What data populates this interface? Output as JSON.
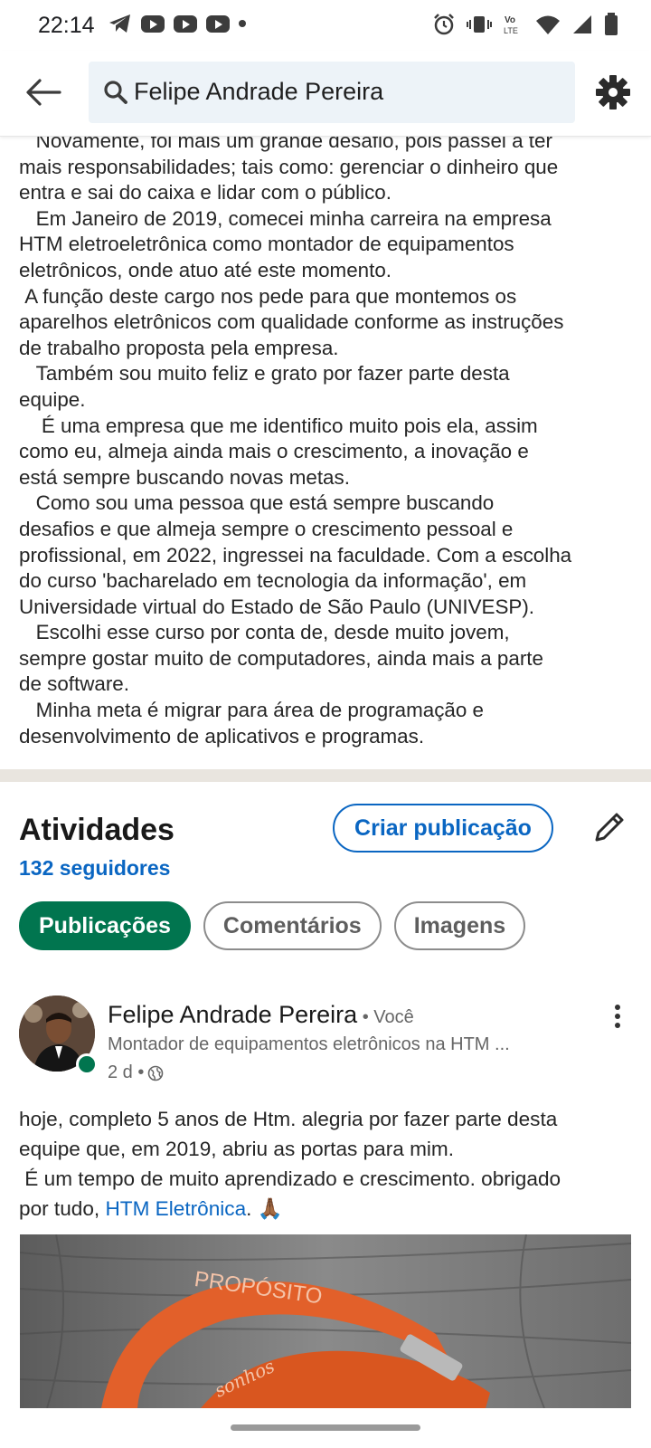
{
  "status_bar": {
    "time": "22:14",
    "left_icons": [
      "telegram-icon",
      "youtube-icon",
      "youtube-icon",
      "youtube-icon",
      "dot-icon"
    ],
    "right_icons": [
      "alarm-icon",
      "vibrate-icon",
      "volte-icon",
      "wifi-icon",
      "signal-icon",
      "battery-icon"
    ]
  },
  "header": {
    "search_value": "Felipe Andrade Pereira"
  },
  "about": {
    "text": "   Novamente, foi mais um grande desafio, pois passei a ter\nmais responsabilidades; tais como: gerenciar o dinheiro que\nentra e sai do caixa e lidar com o público.\n   Em Janeiro de 2019, comecei minha carreira na empresa\nHTM eletroeletrônica como montador de equipamentos\neletrônicos, onde atuo até este momento.\n A função deste cargo nos pede para que montemos os\naparelhos eletrônicos com qualidade conforme as instruções\nde trabalho proposta pela empresa.\n   Também sou muito feliz e grato por fazer parte desta\nequipe.\n    É uma empresa que me identifico muito pois ela, assim\ncomo eu, almeja ainda mais o crescimento, a inovação e\nestá sempre buscando novas metas.\n   Como sou uma pessoa que está sempre buscando\ndesafios e que almeja sempre o crescimento pessoal e\nprofissional, em 2022, ingressei na faculdade. Com a escolha\ndo curso 'bacharelado em tecnologia da informação', em\nUniversidade virtual do Estado de São Paulo (UNIVESP).\n   Escolhi esse curso por conta de, desde muito jovem,\nsempre gostar muito de computadores, ainda mais a parte\nde software.\n   Minha meta é migrar para área de programação e\ndesenvolvimento de aplicativos e programas."
  },
  "activities": {
    "title": "Atividades",
    "followers": "132 seguidores",
    "create_post_label": "Criar publicação",
    "tabs": [
      {
        "label": "Publicações",
        "active": true
      },
      {
        "label": "Comentários",
        "active": false
      },
      {
        "label": "Imagens",
        "active": false
      }
    ]
  },
  "post": {
    "author": "Felipe Andrade Pereira",
    "you_label": " • Você",
    "headline": "Montador de equipamentos eletrônicos na HTM ...",
    "time": "2 d •",
    "text_before_link": "hoje, completo 5 anos de Htm. alegria por fazer parte desta\nequipe que, em 2019, abriu as portas para mim.\n É um tempo de muito aprendizado e crescimento. obrigado\npor tudo, ",
    "link": "HTM Eletrônica",
    "text_after_link": ". 🙏🏾",
    "image_text": "PROPÓSITO",
    "image_script_text": "sonhos"
  },
  "colors": {
    "linkedin_blue": "#0a66c2",
    "active_chip_green": "#01754f",
    "search_bg": "#edf3f8"
  }
}
